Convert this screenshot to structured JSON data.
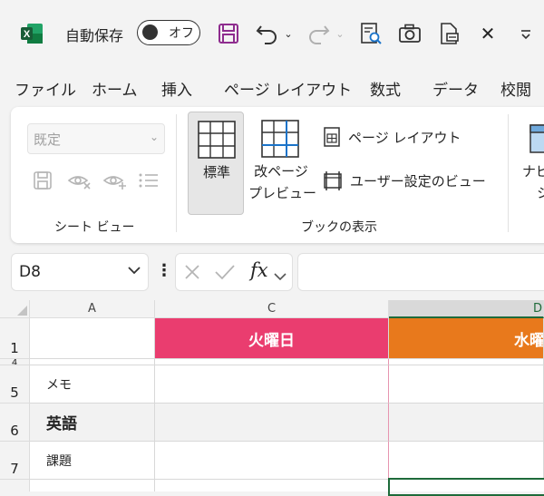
{
  "titlebar": {
    "autosave_label": "自動保存",
    "toggle_text": "オフ"
  },
  "tabs": [
    "ファイル",
    "ホーム",
    "挿入",
    "ページ レイアウト",
    "数式",
    "データ",
    "校閲"
  ],
  "ribbon": {
    "sheet_view_select": "既定",
    "sheet_view_group": "シート ビュー",
    "normal_label": "標準",
    "page_break_label_1": "改ページ",
    "page_break_label_2": "プレビュー",
    "page_layout_label": "ページ レイアウト",
    "custom_views_label": "ユーザー設定のビュー",
    "workbook_views_group": "ブックの表示",
    "nav_label_1": "ナビ",
    "nav_label_2": "シ"
  },
  "formula_bar": {
    "name_box": "D8",
    "fx": "fx",
    "formula": ""
  },
  "sheet": {
    "columns": [
      "A",
      "C",
      "D"
    ],
    "rows": [
      "1",
      "4",
      "5",
      "6",
      "7"
    ],
    "day_headers": [
      "火曜日",
      "水曜"
    ],
    "day_colors": [
      "#ea3d6f",
      "#e8791c"
    ],
    "row_labels": {
      "memo": "メモ",
      "english": "英語",
      "task": "課題"
    }
  }
}
